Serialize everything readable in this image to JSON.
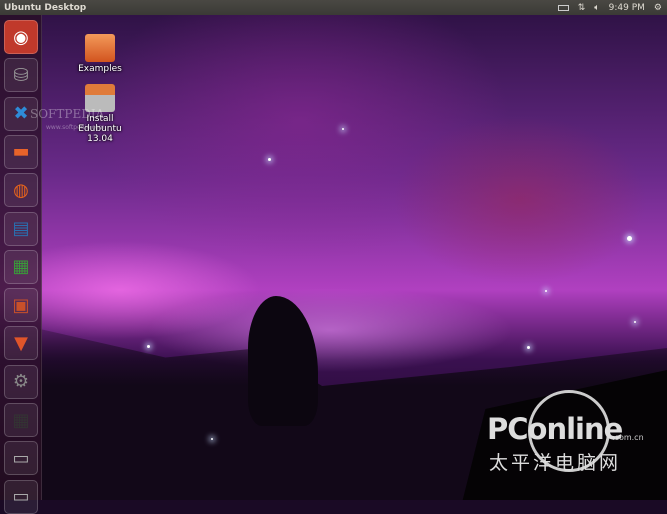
{
  "topbar": {
    "title": "Ubuntu Desktop",
    "clock": "9:49 PM"
  },
  "indicators": [
    "battery-icon",
    "network-icon",
    "volume-icon",
    "gear-icon"
  ],
  "launcher": [
    {
      "name": "ubuntu-dash",
      "glyph": "◉",
      "color": "#d14a1e"
    },
    {
      "name": "install-edubuntu",
      "glyph": "⛁",
      "color": "#999"
    },
    {
      "name": "xpad",
      "glyph": "✖",
      "color": "#2e8bd8"
    },
    {
      "name": "files",
      "glyph": "▬",
      "color": "#e8632a"
    },
    {
      "name": "firefox",
      "glyph": "◍",
      "color": "#e6631c"
    },
    {
      "name": "libreoffice-writer",
      "glyph": "▤",
      "color": "#2a6fb0"
    },
    {
      "name": "libreoffice-calc",
      "glyph": "▦",
      "color": "#3a9a3a"
    },
    {
      "name": "libreoffice-impress",
      "glyph": "▣",
      "color": "#c8502a"
    },
    {
      "name": "software-center",
      "glyph": "▼",
      "color": "#e0552a"
    },
    {
      "name": "system-settings",
      "glyph": "⚙",
      "color": "#888"
    },
    {
      "name": "workspace-switcher",
      "glyph": "▦",
      "color": "#333"
    },
    {
      "name": "drive",
      "glyph": "▭",
      "color": "#aaa"
    },
    {
      "name": "drive-2",
      "glyph": "▭",
      "color": "#aaa"
    }
  ],
  "desktop": {
    "examples": "Examples",
    "install": "Install Edubuntu 13.04"
  },
  "watermark": {
    "softpedia": "SOFTPEDIA",
    "softpedia_url": "www.softpedia.com",
    "pconline": "PConline",
    "domain": ".com.cn",
    "chinese": "太平洋电脑网"
  }
}
